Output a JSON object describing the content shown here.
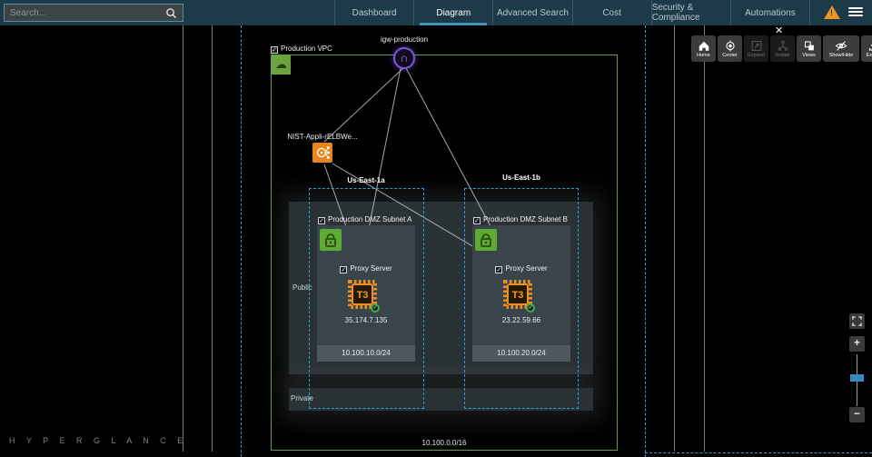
{
  "topbar": {
    "search": {
      "placeholder": "Search..."
    },
    "nav": {
      "items": [
        {
          "label": "Dashboard"
        },
        {
          "label": "Diagram"
        },
        {
          "label": "Advanced Search"
        },
        {
          "label": "Cost"
        },
        {
          "label": "Security & Compliance"
        },
        {
          "label": "Automations"
        }
      ]
    }
  },
  "toolbar": {
    "buttons": [
      {
        "label": "Home",
        "enabled": true
      },
      {
        "label": "Center",
        "enabled": true
      },
      {
        "label": "Expand",
        "enabled": false
      },
      {
        "label": "Isolate",
        "enabled": false
      },
      {
        "label": "Views",
        "enabled": true
      },
      {
        "label": "Show/Hide",
        "enabled": true
      },
      {
        "label": "Export",
        "enabled": true
      }
    ]
  },
  "diagram": {
    "vpc": {
      "label": "Production VPC",
      "cidr": "10.100.0.0/16"
    },
    "igw": {
      "label": "igw-production"
    },
    "elb": {
      "label": "NIST-Appli-rELBWe..."
    },
    "zones": [
      {
        "label": "Us-East-1a"
      },
      {
        "label": "Us-East-1b"
      }
    ],
    "tiers": {
      "public": "Public",
      "private": "Private"
    },
    "subnets": [
      {
        "label": "Production DMZ Subnet A",
        "cidr": "10.100.10.0/24",
        "instance": {
          "label": "Proxy Server",
          "type": "T3",
          "ip": "35.174.7.135"
        }
      },
      {
        "label": "Production DMZ Subnet B",
        "cidr": "10.100.20.0/24",
        "instance": {
          "label": "Proxy Server",
          "type": "T3",
          "ip": "23.22.59.66"
        }
      }
    ]
  },
  "branding": {
    "logo": "H Y P E R G L A N C E"
  },
  "colors": {
    "topbar": "#1d3a49",
    "accent": "#4193ba",
    "vpc_border": "#6a9c4a",
    "az_border": "#2ba0cf",
    "subnet": "#3a444b",
    "orange": "#ef8f1f",
    "green": "#5eaa33",
    "purple": "#7e57e0",
    "warning": "#ef9426"
  }
}
